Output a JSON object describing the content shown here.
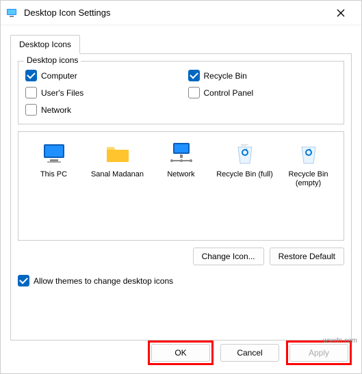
{
  "window": {
    "title": "Desktop Icon Settings"
  },
  "tab": {
    "label": "Desktop Icons"
  },
  "fieldset": {
    "legend": "Desktop icons"
  },
  "checkboxes": {
    "computer": {
      "label": "Computer",
      "checked": true
    },
    "recycle": {
      "label": "Recycle Bin",
      "checked": true
    },
    "userfiles": {
      "label": "User's Files",
      "checked": false
    },
    "control": {
      "label": "Control Panel",
      "checked": false
    },
    "network": {
      "label": "Network",
      "checked": false
    }
  },
  "icons": {
    "thispc": "This PC",
    "user": "Sanal Madanan",
    "network": "Network",
    "rbfull": "Recycle Bin (full)",
    "rbempty": "Recycle Bin (empty)"
  },
  "buttons": {
    "changeicon": "Change Icon...",
    "restore": "Restore Default",
    "ok": "OK",
    "cancel": "Cancel",
    "apply": "Apply"
  },
  "allow": {
    "label": "Allow themes to change desktop icons",
    "checked": true
  },
  "watermark": "wsxdn.com"
}
